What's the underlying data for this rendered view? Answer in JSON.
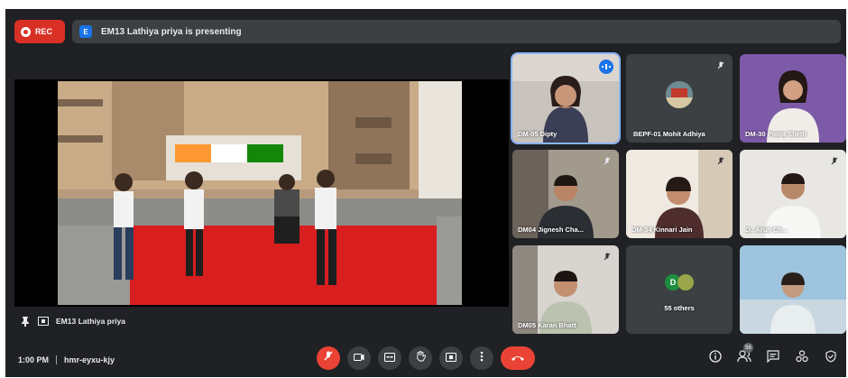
{
  "recording": {
    "label": "REC"
  },
  "presenting": {
    "text": "EM13 Lathiya priya is presenting",
    "initial": "E"
  },
  "stage": {
    "presenter": "EM13 Lathiya priya"
  },
  "tiles": [
    {
      "name": "DM-05 Dipty"
    },
    {
      "name": "BEPF-01 Mohit Adhiya"
    },
    {
      "name": "DM-30 Pooja Sheth"
    },
    {
      "name": "DM04 Jignesh Cha..."
    },
    {
      "name": "DM-34 Kinnari Jain"
    },
    {
      "name": "D.. Arun Ch..."
    },
    {
      "name": "DM05 Karan Bhatt"
    },
    {
      "name": "55 others",
      "initial": "D"
    },
    {
      "name": ""
    }
  ],
  "bottom": {
    "time": "1:00 PM",
    "code": "hmr-eyxu-kjy"
  },
  "people_badge": "56",
  "colors": {
    "background": "#202124",
    "tile": "#3c4043",
    "danger": "#ea4335",
    "accent": "#1a73e8"
  }
}
